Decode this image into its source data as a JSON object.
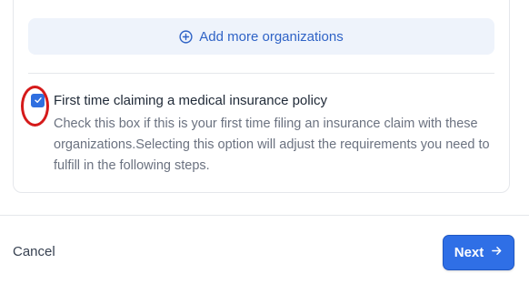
{
  "organizations": {
    "add_label": "Add more organizations",
    "add_icon": "plus-circle-icon"
  },
  "first_time_option": {
    "checked": true,
    "title": "First time claiming a medical insurance policy",
    "description": "Check this box if this is your first time filing an insurance claim with these organizations.Selecting this option will adjust the requirements you need to fulfill in the following steps.",
    "check_icon": "check-icon",
    "highlight_color": "#d51a1a"
  },
  "footer": {
    "cancel_label": "Cancel",
    "next_label": "Next",
    "next_icon": "arrow-right-icon"
  },
  "colors": {
    "accent": "#2f6fe6",
    "add_button_bg": "#eef3fb",
    "add_button_text": "#2f63c6"
  }
}
